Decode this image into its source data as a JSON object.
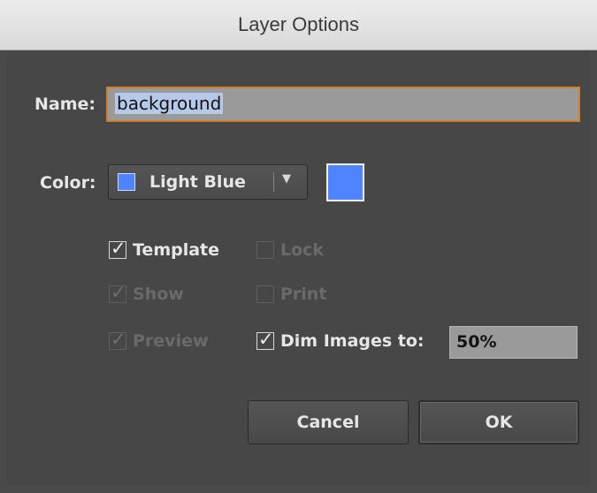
{
  "window": {
    "title": "Layer Options"
  },
  "name_field": {
    "label": "Name:",
    "value": "background"
  },
  "color_field": {
    "label": "Color:",
    "selected": "Light Blue",
    "swatch_color": "#4f83ff",
    "arrow_icon": "triangle-down-icon"
  },
  "options": {
    "template": {
      "label": "Template",
      "checked": true,
      "enabled": true
    },
    "lock": {
      "label": "Lock",
      "checked": false,
      "enabled": false
    },
    "show": {
      "label": "Show",
      "checked": true,
      "enabled": false
    },
    "print": {
      "label": "Print",
      "checked": false,
      "enabled": false
    },
    "preview": {
      "label": "Preview",
      "checked": true,
      "enabled": false
    },
    "dim_images": {
      "label": "Dim Images to:",
      "checked": true,
      "enabled": true,
      "value": "50%"
    }
  },
  "buttons": {
    "cancel": "Cancel",
    "ok": "OK"
  },
  "colors": {
    "accent_focus": "#d27f2a",
    "dialog_bg": "#4a4a4a"
  }
}
